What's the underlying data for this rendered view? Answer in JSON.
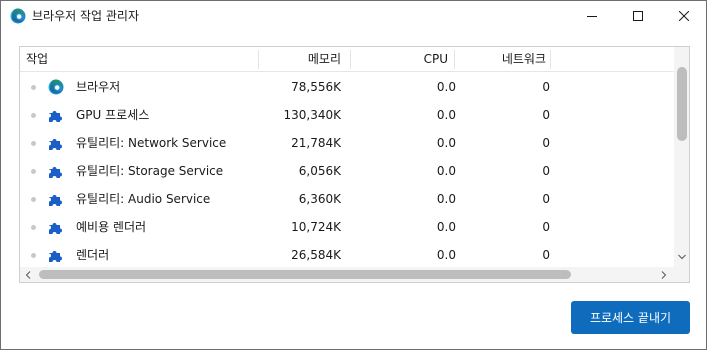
{
  "window": {
    "title": "브라우저 작업 관리자"
  },
  "table": {
    "columns": {
      "task": "작업",
      "memory": "메모리",
      "cpu": "CPU",
      "network": "네트워크"
    },
    "rows": [
      {
        "icon": "edge-icon",
        "name": "브라우저",
        "memory": "78,556K",
        "cpu": "0.0",
        "network": "0"
      },
      {
        "icon": "puzzle-icon",
        "name": "GPU 프로세스",
        "memory": "130,340K",
        "cpu": "0.0",
        "network": "0"
      },
      {
        "icon": "puzzle-icon",
        "name": "유틸리티: Network Service",
        "memory": "21,784K",
        "cpu": "0.0",
        "network": "0"
      },
      {
        "icon": "puzzle-icon",
        "name": "유틸리티: Storage Service",
        "memory": "6,056K",
        "cpu": "0.0",
        "network": "0"
      },
      {
        "icon": "puzzle-icon",
        "name": "유틸리티: Audio Service",
        "memory": "6,360K",
        "cpu": "0.0",
        "network": "0"
      },
      {
        "icon": "puzzle-icon",
        "name": "예비용 렌더러",
        "memory": "10,724K",
        "cpu": "0.0",
        "network": "0"
      },
      {
        "icon": "puzzle-icon",
        "name": "렌더러",
        "memory": "26,584K",
        "cpu": "0.0",
        "network": "0"
      }
    ]
  },
  "footer": {
    "end_process_label": "프로세스 끝내기"
  },
  "colors": {
    "accent": "#0f6cbd",
    "puzzle": "#1a5fc7"
  }
}
